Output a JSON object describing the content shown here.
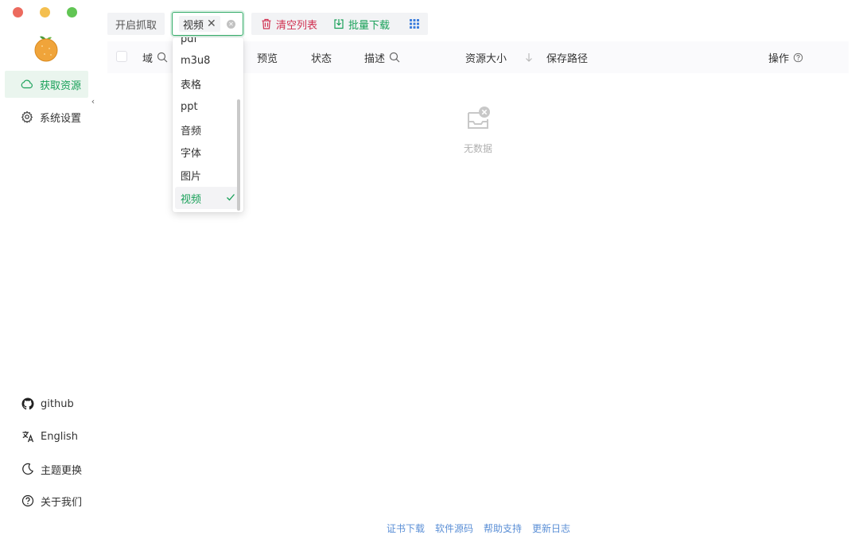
{
  "window": {
    "traffic_lights": [
      {
        "name": "close",
        "color": "#ec6a5e"
      },
      {
        "name": "minimize",
        "color": "#f4bf4f"
      },
      {
        "name": "maximize",
        "color": "#61c554"
      }
    ]
  },
  "sidebar": {
    "logo_icon": "orange-logo-icon",
    "items": [
      {
        "label": "获取资源",
        "icon": "cloud-icon",
        "active": true
      },
      {
        "label": "系统设置",
        "icon": "gear-icon",
        "active": false
      }
    ],
    "collapse_glyph": "‹",
    "bottom": [
      {
        "label": "github",
        "icon": "github-icon"
      },
      {
        "label": "English",
        "icon": "translate-icon"
      },
      {
        "label": "主题更换",
        "icon": "moon-icon"
      },
      {
        "label": "关于我们",
        "icon": "help-circle-icon"
      }
    ]
  },
  "toolbar": {
    "start_label": "开启抓取",
    "select": {
      "tag": "视频",
      "tag_close": "✕",
      "clear": "✕"
    },
    "clear_label": "清空列表",
    "batch_label": "批量下载",
    "colors": {
      "danger": "#d03050",
      "primary": "#18a058",
      "grid": "#3b7ddd"
    }
  },
  "dropdown": {
    "options": [
      "pdf",
      "m3u8",
      "表格",
      "ppt",
      "音频",
      "字体",
      "图片",
      "视频"
    ],
    "selected": "视频"
  },
  "table": {
    "headers": {
      "domain": "域",
      "preview": "预览",
      "status": "状态",
      "description": "描述",
      "size": "资源大小",
      "path": "保存路径",
      "action": "操作"
    },
    "empty_text": "无数据"
  },
  "footer": {
    "links": [
      "证书下载",
      "软件源码",
      "帮助支持",
      "更新日志"
    ]
  }
}
